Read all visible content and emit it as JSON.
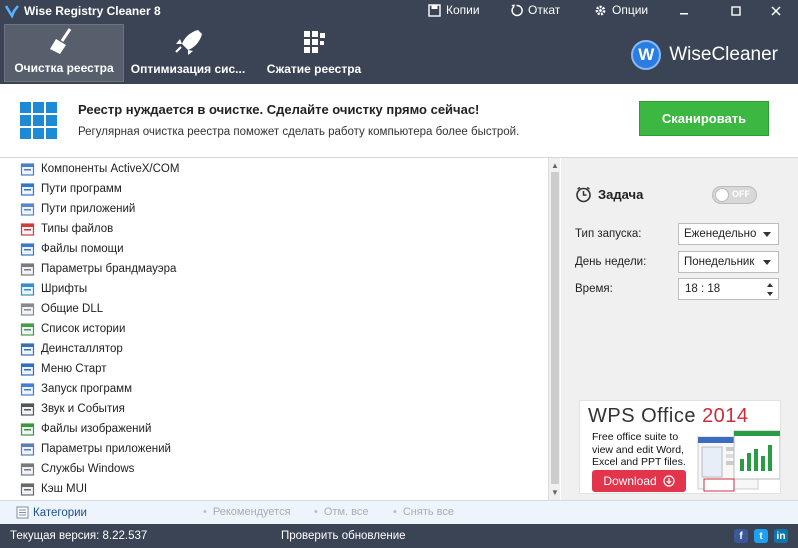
{
  "titlebar": {
    "title": "Wise Registry Cleaner 8",
    "backup_label": "Копии",
    "undo_label": "Откат",
    "options_label": "Опции"
  },
  "nav": {
    "tabs": [
      {
        "label": "Очистка реестра",
        "active": true
      },
      {
        "label": "Оптимизация сис...",
        "active": false
      },
      {
        "label": "Сжатие реестра",
        "active": false
      }
    ],
    "brand": "WiseCleaner",
    "brand_letter": "W"
  },
  "banner": {
    "title": "Реестр нуждается в очистке. Сделайте очистку прямо сейчас!",
    "subtitle": "Регулярная очистка реестра поможет сделать работу компьютера более быстрой.",
    "scan_label": "Сканировать"
  },
  "list": {
    "items": [
      {
        "label": "Компоненты ActiveX/COM",
        "icon": "activex-icon"
      },
      {
        "label": "Пути программ",
        "icon": "program-paths-icon"
      },
      {
        "label": "Пути приложений",
        "icon": "app-paths-icon"
      },
      {
        "label": "Типы файлов",
        "icon": "file-types-icon"
      },
      {
        "label": "Файлы помощи",
        "icon": "help-files-icon"
      },
      {
        "label": "Параметры брандмауэра",
        "icon": "firewall-icon"
      },
      {
        "label": "Шрифты",
        "icon": "fonts-icon"
      },
      {
        "label": "Общие DLL",
        "icon": "dll-icon"
      },
      {
        "label": "Список истории",
        "icon": "history-icon"
      },
      {
        "label": "Деинсталлятор",
        "icon": "uninstaller-icon"
      },
      {
        "label": "Меню Старт",
        "icon": "start-menu-icon"
      },
      {
        "label": "Запуск программ",
        "icon": "startup-icon"
      },
      {
        "label": "Звук и События",
        "icon": "sound-icon"
      },
      {
        "label": "Файлы изображений",
        "icon": "image-files-icon"
      },
      {
        "label": "Параметры приложений",
        "icon": "app-settings-icon"
      },
      {
        "label": "Службы Windows",
        "icon": "services-icon"
      },
      {
        "label": "Кэш MUI",
        "icon": "mui-cache-icon"
      }
    ]
  },
  "schedule": {
    "title": "Задача",
    "toggle_label": "OFF",
    "run_type_label": "Тип запуска:",
    "run_type_value": "Еженедельно",
    "weekday_label": "День недели:",
    "weekday_value": "Понедельник",
    "time_label": "Время:",
    "time_value": "18 : 18"
  },
  "ad": {
    "logo": "WPS Office",
    "year": "2014",
    "text": "Free office suite to view and edit Word, Excel and PPT files.",
    "download_label": "Download"
  },
  "bottombar": {
    "categories_label": "Категории",
    "recommended_label": "Рекомендуется",
    "select_all_label": "Отм. все",
    "deselect_all_label": "Снять все"
  },
  "statusbar": {
    "version": "Текущая версия: 8.22.537",
    "check_update": "Проверить обновление"
  },
  "colors": {
    "dark": "#3b4454",
    "scan_green": "#3cb742",
    "link_blue": "#1d4f91"
  }
}
